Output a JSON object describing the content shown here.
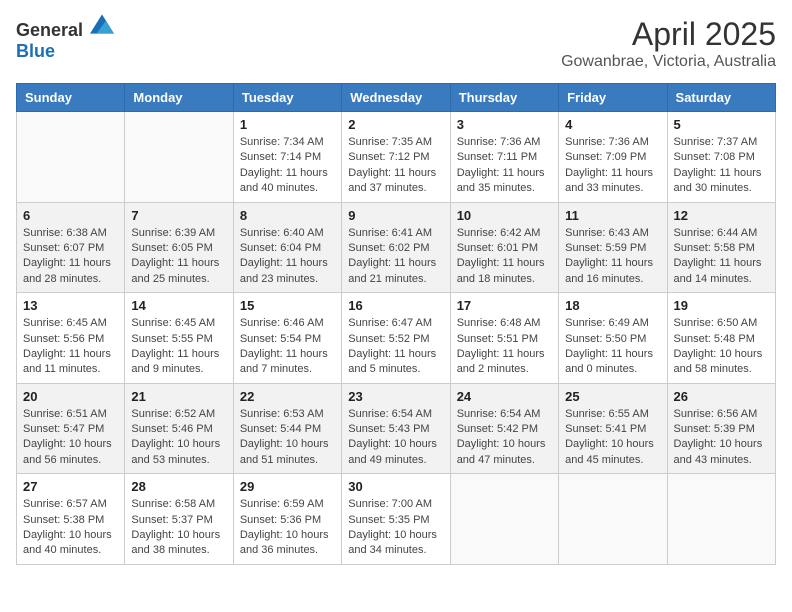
{
  "header": {
    "logo_general": "General",
    "logo_blue": "Blue",
    "title": "April 2025",
    "subtitle": "Gowanbrae, Victoria, Australia"
  },
  "weekdays": [
    "Sunday",
    "Monday",
    "Tuesday",
    "Wednesday",
    "Thursday",
    "Friday",
    "Saturday"
  ],
  "weeks": [
    [
      {
        "day": "",
        "info": ""
      },
      {
        "day": "",
        "info": ""
      },
      {
        "day": "1",
        "info": "Sunrise: 7:34 AM\nSunset: 7:14 PM\nDaylight: 11 hours and 40 minutes."
      },
      {
        "day": "2",
        "info": "Sunrise: 7:35 AM\nSunset: 7:12 PM\nDaylight: 11 hours and 37 minutes."
      },
      {
        "day": "3",
        "info": "Sunrise: 7:36 AM\nSunset: 7:11 PM\nDaylight: 11 hours and 35 minutes."
      },
      {
        "day": "4",
        "info": "Sunrise: 7:36 AM\nSunset: 7:09 PM\nDaylight: 11 hours and 33 minutes."
      },
      {
        "day": "5",
        "info": "Sunrise: 7:37 AM\nSunset: 7:08 PM\nDaylight: 11 hours and 30 minutes."
      }
    ],
    [
      {
        "day": "6",
        "info": "Sunrise: 6:38 AM\nSunset: 6:07 PM\nDaylight: 11 hours and 28 minutes."
      },
      {
        "day": "7",
        "info": "Sunrise: 6:39 AM\nSunset: 6:05 PM\nDaylight: 11 hours and 25 minutes."
      },
      {
        "day": "8",
        "info": "Sunrise: 6:40 AM\nSunset: 6:04 PM\nDaylight: 11 hours and 23 minutes."
      },
      {
        "day": "9",
        "info": "Sunrise: 6:41 AM\nSunset: 6:02 PM\nDaylight: 11 hours and 21 minutes."
      },
      {
        "day": "10",
        "info": "Sunrise: 6:42 AM\nSunset: 6:01 PM\nDaylight: 11 hours and 18 minutes."
      },
      {
        "day": "11",
        "info": "Sunrise: 6:43 AM\nSunset: 5:59 PM\nDaylight: 11 hours and 16 minutes."
      },
      {
        "day": "12",
        "info": "Sunrise: 6:44 AM\nSunset: 5:58 PM\nDaylight: 11 hours and 14 minutes."
      }
    ],
    [
      {
        "day": "13",
        "info": "Sunrise: 6:45 AM\nSunset: 5:56 PM\nDaylight: 11 hours and 11 minutes."
      },
      {
        "day": "14",
        "info": "Sunrise: 6:45 AM\nSunset: 5:55 PM\nDaylight: 11 hours and 9 minutes."
      },
      {
        "day": "15",
        "info": "Sunrise: 6:46 AM\nSunset: 5:54 PM\nDaylight: 11 hours and 7 minutes."
      },
      {
        "day": "16",
        "info": "Sunrise: 6:47 AM\nSunset: 5:52 PM\nDaylight: 11 hours and 5 minutes."
      },
      {
        "day": "17",
        "info": "Sunrise: 6:48 AM\nSunset: 5:51 PM\nDaylight: 11 hours and 2 minutes."
      },
      {
        "day": "18",
        "info": "Sunrise: 6:49 AM\nSunset: 5:50 PM\nDaylight: 11 hours and 0 minutes."
      },
      {
        "day": "19",
        "info": "Sunrise: 6:50 AM\nSunset: 5:48 PM\nDaylight: 10 hours and 58 minutes."
      }
    ],
    [
      {
        "day": "20",
        "info": "Sunrise: 6:51 AM\nSunset: 5:47 PM\nDaylight: 10 hours and 56 minutes."
      },
      {
        "day": "21",
        "info": "Sunrise: 6:52 AM\nSunset: 5:46 PM\nDaylight: 10 hours and 53 minutes."
      },
      {
        "day": "22",
        "info": "Sunrise: 6:53 AM\nSunset: 5:44 PM\nDaylight: 10 hours and 51 minutes."
      },
      {
        "day": "23",
        "info": "Sunrise: 6:54 AM\nSunset: 5:43 PM\nDaylight: 10 hours and 49 minutes."
      },
      {
        "day": "24",
        "info": "Sunrise: 6:54 AM\nSunset: 5:42 PM\nDaylight: 10 hours and 47 minutes."
      },
      {
        "day": "25",
        "info": "Sunrise: 6:55 AM\nSunset: 5:41 PM\nDaylight: 10 hours and 45 minutes."
      },
      {
        "day": "26",
        "info": "Sunrise: 6:56 AM\nSunset: 5:39 PM\nDaylight: 10 hours and 43 minutes."
      }
    ],
    [
      {
        "day": "27",
        "info": "Sunrise: 6:57 AM\nSunset: 5:38 PM\nDaylight: 10 hours and 40 minutes."
      },
      {
        "day": "28",
        "info": "Sunrise: 6:58 AM\nSunset: 5:37 PM\nDaylight: 10 hours and 38 minutes."
      },
      {
        "day": "29",
        "info": "Sunrise: 6:59 AM\nSunset: 5:36 PM\nDaylight: 10 hours and 36 minutes."
      },
      {
        "day": "30",
        "info": "Sunrise: 7:00 AM\nSunset: 5:35 PM\nDaylight: 10 hours and 34 minutes."
      },
      {
        "day": "",
        "info": ""
      },
      {
        "day": "",
        "info": ""
      },
      {
        "day": "",
        "info": ""
      }
    ]
  ]
}
